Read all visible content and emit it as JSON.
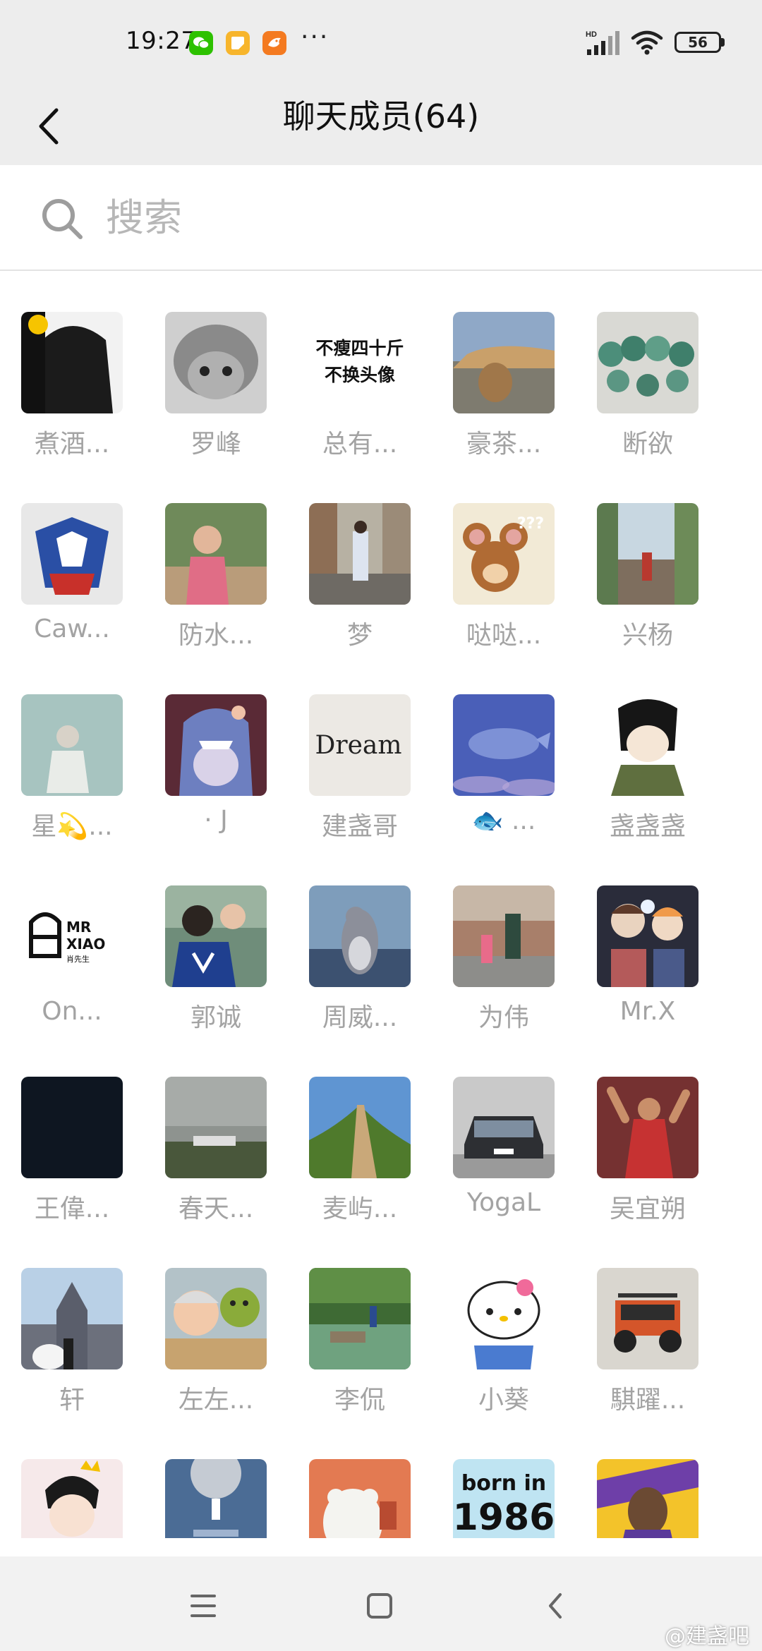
{
  "status_bar": {
    "time": "19:27",
    "more": "···",
    "network": "HD",
    "battery": "56",
    "notification_icons": [
      "wechat-icon",
      "notes-app-icon",
      "bird-app-icon"
    ]
  },
  "header": {
    "title": "聊天成员(64)"
  },
  "search": {
    "placeholder": "搜索"
  },
  "members": [
    {
      "name": "煮酒...",
      "avatar": "ink-portrait-avatar"
    },
    {
      "name": "罗峰",
      "avatar": "gray-cat-avatar"
    },
    {
      "name": "总有...",
      "avatar": "text-avatar",
      "avatar_text": [
        "不瘦四十斤",
        "不换头像"
      ]
    },
    {
      "name": "豪茶...",
      "avatar": "tabby-cat-avatar"
    },
    {
      "name": "断欲",
      "avatar": "jade-bracelet-avatar"
    },
    {
      "name": "Caw...",
      "avatar": "gundam-avatar"
    },
    {
      "name": "防水...",
      "avatar": "child-photo-avatar"
    },
    {
      "name": "梦",
      "avatar": "street-photo-avatar"
    },
    {
      "name": "哒哒...",
      "avatar": "cartoon-mouse-avatar",
      "avatar_text": [
        "???"
      ]
    },
    {
      "name": "兴杨",
      "avatar": "stairs-photo-avatar"
    },
    {
      "name": "星💫...",
      "avatar": "misty-child-avatar"
    },
    {
      "name": "· J",
      "avatar": "shark-cartoon-avatar"
    },
    {
      "name": "建盏哥",
      "avatar": "dream-script-avatar",
      "avatar_text": [
        "Dream"
      ]
    },
    {
      "name": "🐟 ...",
      "avatar": "whale-illustration-avatar"
    },
    {
      "name": "盏盏盏",
      "avatar": "anime-soldier-avatar"
    },
    {
      "name": "On...",
      "avatar": "mr-xiao-logo-avatar",
      "avatar_text": [
        "MR",
        "XIAO",
        "肖先生"
      ]
    },
    {
      "name": "郭诚",
      "avatar": "family-photo-avatar"
    },
    {
      "name": "周威...",
      "avatar": "cartoon-cat-avatar"
    },
    {
      "name": "为伟",
      "avatar": "walking-photo-avatar"
    },
    {
      "name": "Mr.X",
      "avatar": "anime-duo-avatar"
    },
    {
      "name": "王偉...",
      "avatar": "dark-avatar"
    },
    {
      "name": "春天...",
      "avatar": "foggy-landscape-avatar"
    },
    {
      "name": "麦屿...",
      "avatar": "great-wall-avatar"
    },
    {
      "name": "YogaL",
      "avatar": "car-photo-avatar"
    },
    {
      "name": "吴宜朔",
      "avatar": "basketball-anime-avatar"
    },
    {
      "name": "轩",
      "avatar": "church-wedding-avatar"
    },
    {
      "name": "左左...",
      "avatar": "baby-shrek-avatar"
    },
    {
      "name": "李侃",
      "avatar": "river-photo-avatar"
    },
    {
      "name": "小葵",
      "avatar": "hello-kitty-avatar"
    },
    {
      "name": "騏躍...",
      "avatar": "jeep-avatar"
    },
    {
      "name": "",
      "avatar": "anime-boy-avatar"
    },
    {
      "name": "",
      "avatar": "moon-illustration-avatar"
    },
    {
      "name": "",
      "avatar": "bear-cartoon-avatar"
    },
    {
      "name": "",
      "avatar": "born-in-text-avatar",
      "avatar_text": [
        "born in",
        "1986"
      ]
    },
    {
      "name": "",
      "avatar": "basketball-player-avatar"
    }
  ],
  "bottom_nav": {
    "watermark": "@建盏吧",
    "keys": [
      "menu-icon",
      "home-square-icon",
      "back-chevron-icon"
    ]
  },
  "colors": {
    "header_bg": "#ededed",
    "name_gray": "#a3a3a3",
    "placeholder_gray": "#b7b7b7"
  }
}
